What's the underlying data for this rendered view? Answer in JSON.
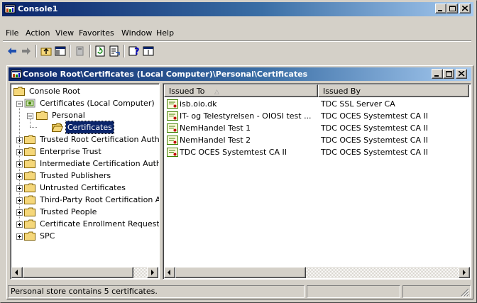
{
  "app": {
    "title": "Console1",
    "icon": "mmc-console-icon"
  },
  "menu": {
    "items": [
      "File",
      "Action",
      "View",
      "Favorites",
      "Window",
      "Help"
    ]
  },
  "toolbar": {
    "buttons": [
      "back-arrow-icon",
      "forward-arrow-icon",
      "up-folder-icon",
      "show-hide-tree-icon",
      "delete-icon",
      "refresh-icon",
      "export-list-icon",
      "help-icon",
      "properties-icon"
    ]
  },
  "child_window": {
    "title": "Console Root\\Certificates (Local Computer)\\Personal\\Certificates"
  },
  "tree": {
    "root": "Console Root",
    "store": "Certificates (Local Computer)",
    "personal": "Personal",
    "selected": "Certificates",
    "children": [
      "Trusted Root Certification Authorities",
      "Enterprise Trust",
      "Intermediate Certification Authorities",
      "Trusted Publishers",
      "Untrusted Certificates",
      "Third-Party Root Certification Authorities",
      "Trusted People",
      "Certificate Enrollment Requests",
      "SPC"
    ]
  },
  "list": {
    "columns": [
      "Issued To",
      "Issued By"
    ],
    "sort_indicator": "△",
    "rows": [
      {
        "issued_to": "isb.oio.dk",
        "issued_by": "TDC SSL Server CA"
      },
      {
        "issued_to": "IT- og Telestyrelsen - OIOSI test ...",
        "issued_by": "TDC OCES Systemtest CA II"
      },
      {
        "issued_to": "NemHandel Test 1",
        "issued_by": "TDC OCES Systemtest CA II"
      },
      {
        "issued_to": "NemHandel Test 2",
        "issued_by": "TDC OCES Systemtest CA II"
      },
      {
        "issued_to": "TDC OCES Systemtest CA II",
        "issued_by": "TDC OCES Systemtest CA II"
      }
    ]
  },
  "status": {
    "message": "Personal store contains 5 certificates."
  },
  "colors": {
    "title_active": "#0a246a",
    "title_gradient_end": "#a6caf0",
    "face": "#d4d0c8",
    "selection": "#0a246a",
    "folder": "#f5d77a"
  }
}
